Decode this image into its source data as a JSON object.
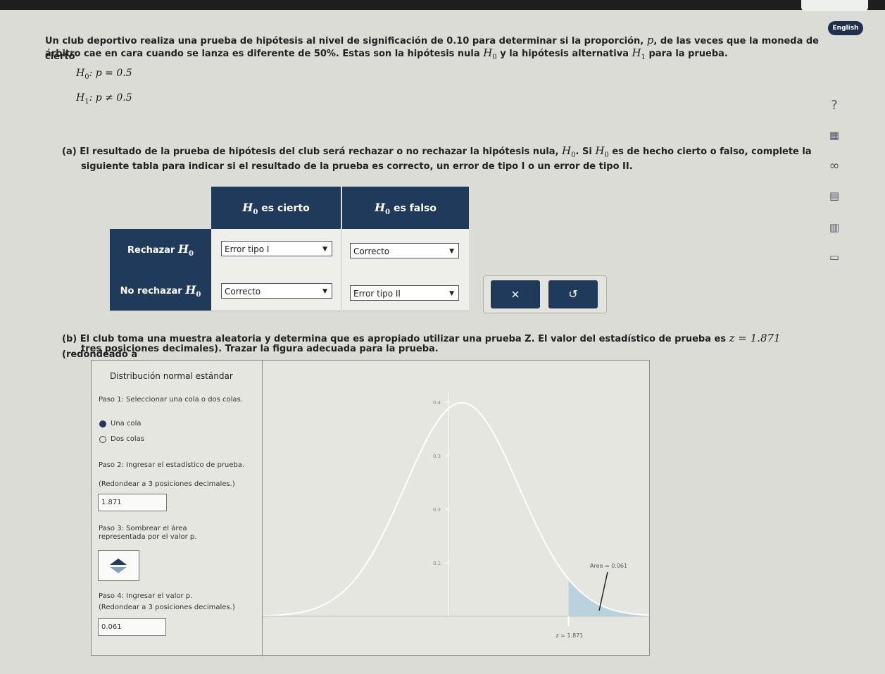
{
  "problem": {
    "line1": "Un club deportivo realiza una prueba de hipótesis al nivel de significación de 0.10 para determinar si la proporción,",
    "line1_p": "p",
    "line1_end": ", de las veces que la moneda de cierto",
    "line2": "árbitro cae en cara cuando se lanza es diferente de 50%. Estas son la hipótesis nula",
    "line2_mid": "y la hipótesis alternativa",
    "line2_end": "para la prueba.",
    "h0_eq": ": p = 0.5",
    "h1_eq": ": p ≠ 0.5"
  },
  "part_a": {
    "label": "(a)",
    "text1": "El resultado de la prueba de hipótesis del club será rechazar o no rechazar la hipótesis nula,",
    "text1b": ". Si",
    "text1c": "es de hecho cierto o falso, complete la",
    "text2": "siguiente tabla para indicar si el resultado de la prueba es correcto, un error de tipo I o un error de tipo II."
  },
  "table": {
    "col1": "es cierto",
    "col2": "es falso",
    "row1": "Rechazar",
    "row2": "No rechazar",
    "cells": [
      "Error tipo I",
      "Correcto",
      "Correcto",
      "Error tipo II"
    ]
  },
  "buttons": {
    "clear": "×",
    "undo": "↺"
  },
  "part_b": {
    "label": "(b)",
    "text1": "El club toma una muestra aleatoria y determina que es apropiado utilizar una prueba Z. El valor del estadístico de prueba es",
    "z_value": "z = 1.871",
    "text1_end": "(redondeado a",
    "text2": "tres posiciones decimales). Trazar la figura adecuada para la prueba."
  },
  "tool": {
    "title": "Distribución normal estándar",
    "step1": "Paso 1: Seleccionar una cola o dos colas.",
    "opt1": "Una cola",
    "opt2": "Dos colas",
    "step2": "Paso 2: Ingresar el estadístico de prueba.",
    "step2b": "(Redondear a 3 posiciones decimales.)",
    "stat_value": "1.871",
    "step3": "Paso 3: Sombrear el área representada por el valor p.",
    "step4": "Paso 4: Ingresar el valor p.",
    "step4b": "(Redondear a 3 posiciones decimales.)",
    "p_value": "0.061",
    "area_label": "Area = 0.061",
    "z_label": "z = 1.871",
    "y_ticks": [
      "0.4",
      "0.3",
      "0.2",
      "0.1"
    ]
  },
  "sidebar": {
    "english": "English",
    "help": "?"
  },
  "colors": {
    "navy": "#1f3a5a",
    "shade": "#b9d3de"
  }
}
